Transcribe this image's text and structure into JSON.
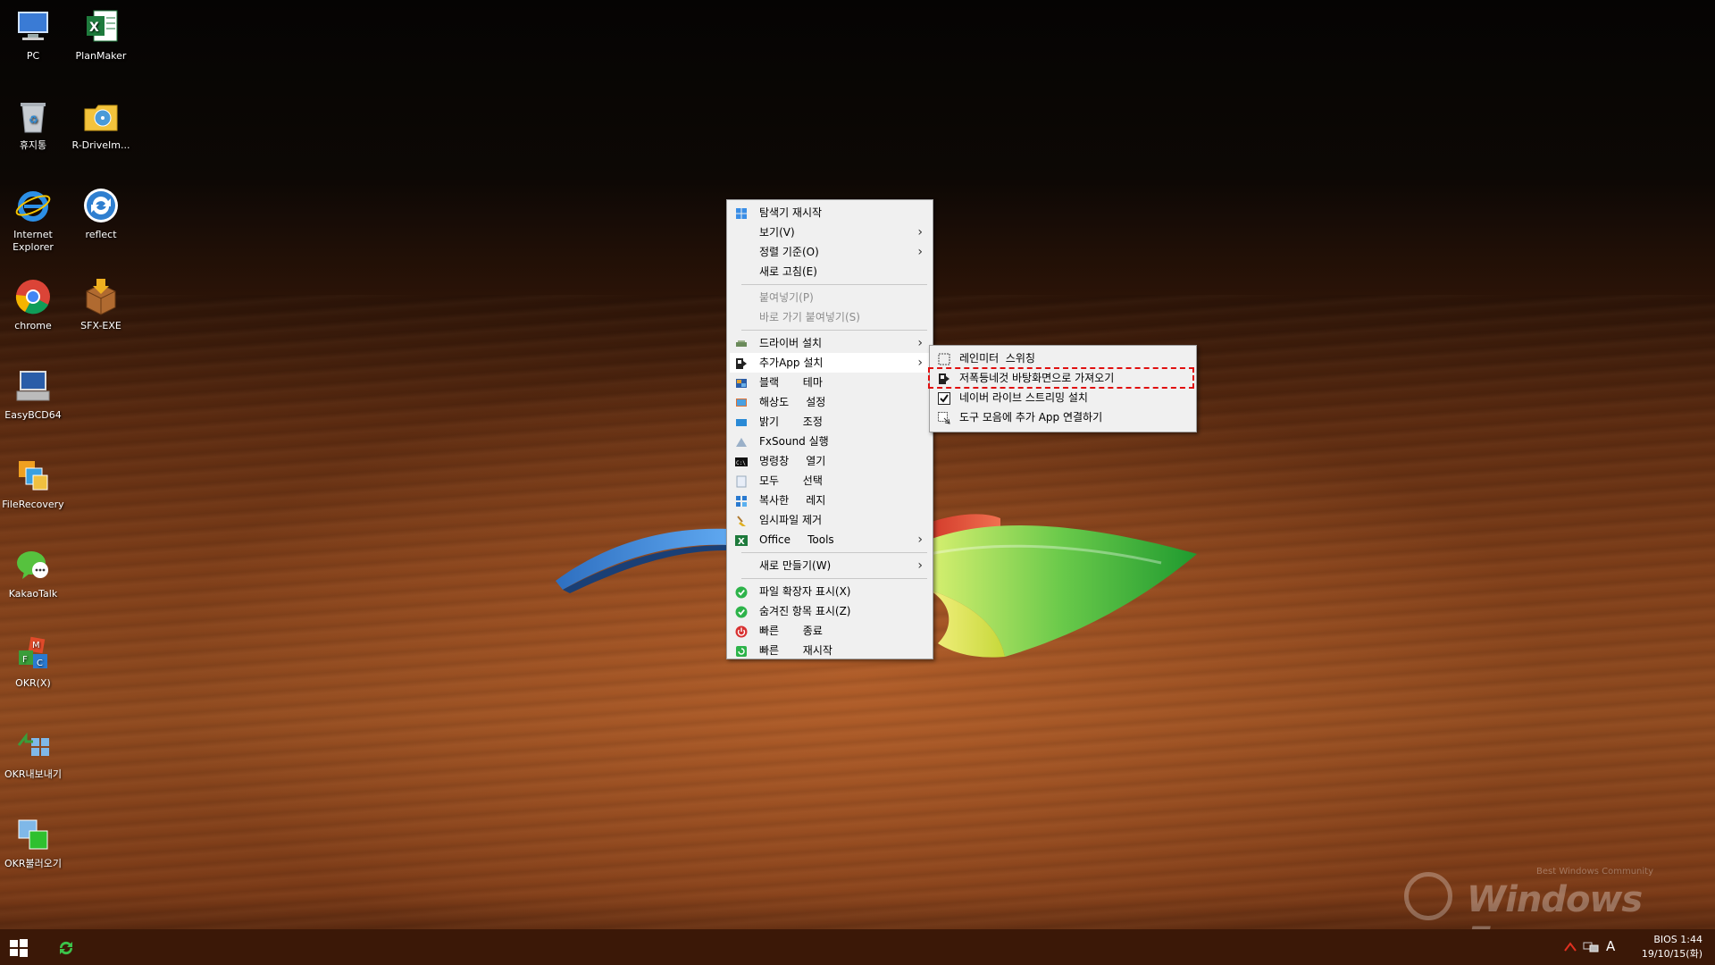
{
  "desktop": {
    "icons": [
      {
        "label": "PC",
        "icon": "computer-icon"
      },
      {
        "label": "PlanMaker",
        "icon": "planmaker-icon"
      },
      {
        "label": "휴지통",
        "icon": "recycle-bin-icon"
      },
      {
        "label": "R-DriveIm...",
        "icon": "r-drive-icon"
      },
      {
        "label": "Internet Explorer",
        "icon": "internet-explorer-icon"
      },
      {
        "label": "reflect",
        "icon": "reflect-icon"
      },
      {
        "label": "chrome",
        "icon": "chrome-icon"
      },
      {
        "label": "SFX-EXE",
        "icon": "sfx-exe-icon"
      },
      {
        "label": "EasyBCD64",
        "icon": "easybcd-icon"
      },
      {
        "label": "FileRecovery",
        "icon": "file-recovery-icon"
      },
      {
        "label": "KakaoTalk",
        "icon": "kakaotalk-icon"
      },
      {
        "label": "OKR(X)",
        "icon": "okr-icon"
      },
      {
        "label": "OKR내보내기",
        "icon": "okr-export-icon"
      },
      {
        "label": "OKR불러오기",
        "icon": "okr-import-icon"
      }
    ]
  },
  "context_menu": {
    "items": [
      {
        "label": "탐색기 재시작",
        "icon": "windows-tiles-icon"
      },
      {
        "label": "보기(V)",
        "submenu": true
      },
      {
        "label": "정렬 기준(O)",
        "submenu": true
      },
      {
        "label": "새로 고침(E)"
      },
      {
        "label": "붙여넣기(P)",
        "disabled": true
      },
      {
        "label": "바로 가기 붙여넣기(S)",
        "disabled": true
      },
      {
        "label": "드라이버 설치",
        "icon": "driver-icon",
        "submenu": true
      },
      {
        "label": "추가App 설치",
        "icon": "app-install-icon",
        "submenu": true,
        "hovered": true
      },
      {
        "label": "블랙       테마",
        "icon": "theme-icon"
      },
      {
        "label": "해상도     설정",
        "icon": "resolution-icon"
      },
      {
        "label": "밝기       조정",
        "icon": "brightness-icon"
      },
      {
        "label": "FxSound 실행",
        "icon": "fxsound-icon"
      },
      {
        "label": "명령창     열기",
        "icon": "cmd-icon"
      },
      {
        "label": "모두       선택",
        "icon": "select-all-icon"
      },
      {
        "label": "복사한     레지",
        "icon": "registry-icon"
      },
      {
        "label": "임시파일 제거",
        "icon": "broom-icon"
      },
      {
        "label": "Office     Tools",
        "icon": "excel-icon",
        "submenu": true
      },
      {
        "label": "새로 만들기(W)",
        "submenu": true
      },
      {
        "label": "파일 확장자 표시(X)",
        "icon": "check-circle-icon"
      },
      {
        "label": "숨겨진 항목 표시(Z)",
        "icon": "check-circle-icon"
      },
      {
        "label": "빠른       종료",
        "icon": "power-icon"
      },
      {
        "label": "빠른       재시작",
        "icon": "restart-icon"
      }
    ]
  },
  "submenu": {
    "items": [
      {
        "label": "레인미터  스위칭",
        "icon": "rainmeter-icon"
      },
      {
        "label": "저폭등네것 바탕화면으로 가져오기",
        "icon": "app-install-icon",
        "highlighted": true
      },
      {
        "label": "네이버 라이브 스트리밍 설치",
        "icon": "checkbox-checked-icon"
      },
      {
        "label": "도구 모음에 추가 App 연결하기",
        "icon": "toolbar-link-icon"
      }
    ]
  },
  "taskbar": {
    "tray_text": "A",
    "clock_top": "BIOS  1:44",
    "clock_bottom": "19/10/15(화)"
  },
  "watermark": {
    "title": "Windows Forum",
    "subtitle": "Best Windows Community"
  },
  "colors": {
    "menu_bg": "#f0f0f0",
    "highlight_border": "#e01010",
    "taskbar_bg": "#3b1807"
  }
}
